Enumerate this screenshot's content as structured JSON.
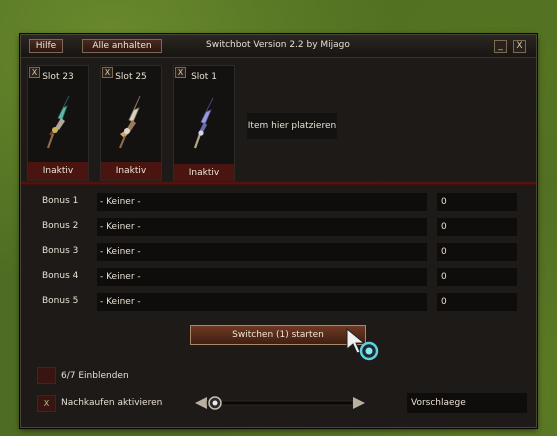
{
  "titlebar": {
    "help_label": "Hilfe",
    "stop_all_label": "Alle anhalten",
    "title": "Switchbot Version 2.2 by Mijago",
    "minimize_symbol": "_",
    "close_symbol": "X"
  },
  "slots": [
    {
      "label": "Slot 23",
      "status": "Inaktiv",
      "close_symbol": "X",
      "weapon_icon": "spear-icon"
    },
    {
      "label": "Slot 25",
      "status": "Inaktiv",
      "close_symbol": "X",
      "weapon_icon": "spear-icon"
    },
    {
      "label": "Slot 1",
      "status": "Inaktiv",
      "close_symbol": "X",
      "weapon_icon": "spear-icon"
    }
  ],
  "place_item_label": "Item hier platzieren",
  "bonuses": [
    {
      "label": "Bonus 1",
      "selected": "- Keiner -",
      "value": "0"
    },
    {
      "label": "Bonus 2",
      "selected": "- Keiner -",
      "value": "0"
    },
    {
      "label": "Bonus 3",
      "selected": "- Keiner -",
      "value": "0"
    },
    {
      "label": "Bonus 4",
      "selected": "- Keiner -",
      "value": "0"
    },
    {
      "label": "Bonus 5",
      "selected": "- Keiner -",
      "value": "0"
    }
  ],
  "start_button_label": "Switchen (1) starten",
  "show_toggle": {
    "label": "6/7 Einblenden",
    "checked_mark": ""
  },
  "rebuy_toggle": {
    "label": "Nachkaufen aktivieren",
    "checked_mark": "X"
  },
  "suggestions_label": "Vorschlaege",
  "colors": {
    "window_bg": "#1d1a17",
    "status_red": "#4a1410",
    "button_brown": "#6e3a22",
    "input_bg": "#0e0d0b"
  }
}
